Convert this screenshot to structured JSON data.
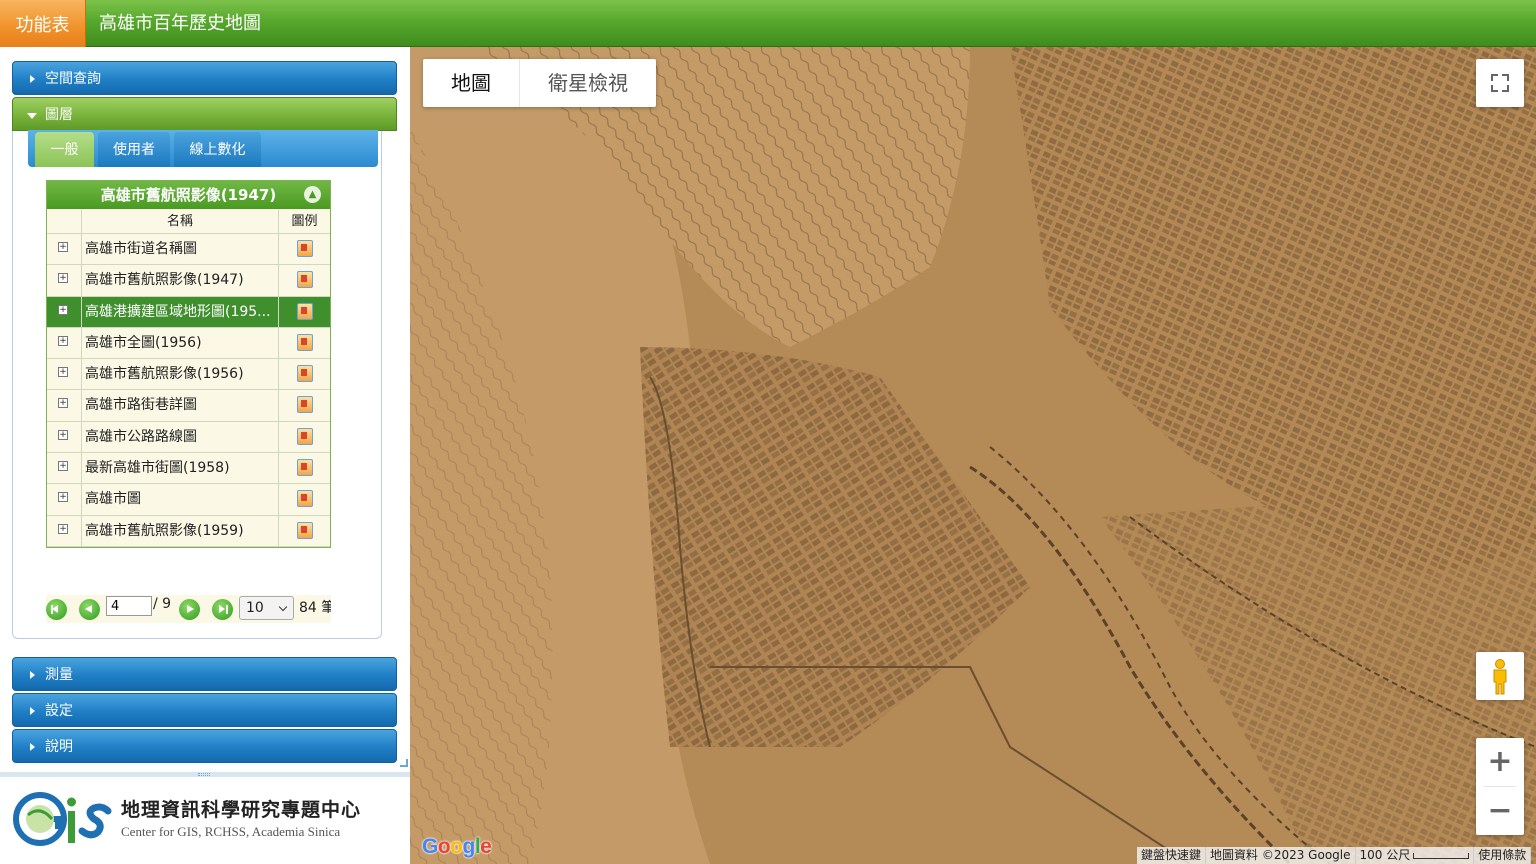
{
  "header": {
    "menu_label": "功能表",
    "title": "高雄市百年歷史地圖"
  },
  "sidebar": {
    "sections": {
      "spatial_query": "空間查詢",
      "layers": "圖層",
      "measure": "測量",
      "settings": "設定",
      "help": "說明"
    },
    "tabs": [
      "一般",
      "使用者",
      "線上數化"
    ],
    "grid": {
      "title": "高雄市舊航照影像(1947)",
      "col_name": "名稱",
      "col_legend": "圖例",
      "rows": [
        {
          "name": "高雄市街道名稱圖"
        },
        {
          "name": "高雄市舊航照影像(1947)"
        },
        {
          "name": "高雄港擴建區域地形圖(195..."
        },
        {
          "name": "高雄市全圖(1956)"
        },
        {
          "name": "高雄市舊航照影像(1956)"
        },
        {
          "name": "高雄市路街巷詳圖"
        },
        {
          "name": "高雄市公路路線圖"
        },
        {
          "name": "最新高雄市街圖(1958)"
        },
        {
          "name": "高雄市圖"
        },
        {
          "name": "高雄市舊航照影像(1959)"
        }
      ],
      "selected_row": 2
    },
    "pager": {
      "current_page": "4",
      "total_pages": "/ 9",
      "page_size": "10",
      "record_count": "84 筆"
    },
    "logo": {
      "mark": "GiS",
      "org_name": "地理資訊科學研究專題中心",
      "org_sub": "Center for GIS, RCHSS, Academia Sinica"
    }
  },
  "map": {
    "map_type": {
      "map": "地圖",
      "satellite": "衛星檢視"
    },
    "zoom_in": "+",
    "zoom_out": "−",
    "google": "Google",
    "attribution": {
      "shortcuts": "鍵盤快速鍵",
      "data": "地圖資料 ©2023 Google",
      "scale": "100 公尺",
      "terms": "使用條款"
    }
  },
  "colors": {
    "header_green": "#58a82e",
    "menu_orange": "#f0912a",
    "accordion_blue": "#1f7fc6",
    "accordion_green": "#79b33c",
    "selected_row": "#3f8f2d",
    "map_paper": "#b48a57"
  }
}
